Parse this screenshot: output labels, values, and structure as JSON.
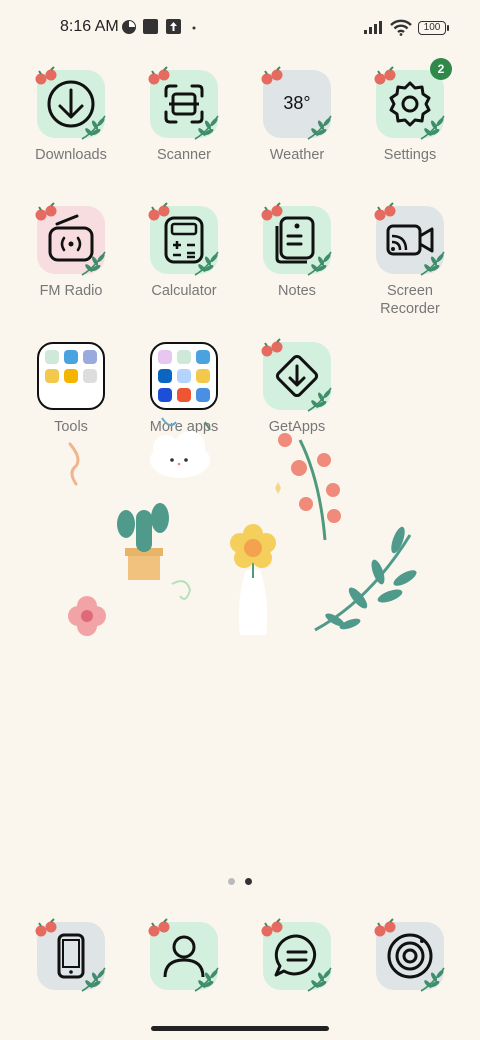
{
  "status_bar": {
    "time": "8:16 AM",
    "battery": "100"
  },
  "apps": [
    {
      "label": "Downloads",
      "icon": "download-icon",
      "bg": "#d3efde"
    },
    {
      "label": "Scanner",
      "icon": "scanner-icon",
      "bg": "#d3efde"
    },
    {
      "label": "Weather",
      "icon": "weather-icon",
      "bg": "#dfe4e6",
      "temp": "38°"
    },
    {
      "label": "Settings",
      "icon": "gear-icon",
      "bg": "#d3efde",
      "badge": "2"
    },
    {
      "label": "FM Radio",
      "icon": "radio-icon",
      "bg": "#f7dce0"
    },
    {
      "label": "Calculator",
      "icon": "calculator-icon",
      "bg": "#d3efde"
    },
    {
      "label": "Notes",
      "icon": "notes-icon",
      "bg": "#d3efde"
    },
    {
      "label": "Screen Recorder",
      "icon": "screen-recorder-icon",
      "bg": "#dfe4e6"
    },
    {
      "label": "Tools",
      "icon": "folder-icon"
    },
    {
      "label": "More apps",
      "icon": "folder-icon"
    },
    {
      "label": "GetApps",
      "icon": "getapps-icon",
      "bg": "#d3efde"
    }
  ],
  "dock": [
    {
      "icon": "phone-icon",
      "bg": "#dfe4e6"
    },
    {
      "icon": "contacts-icon",
      "bg": "#d3efde"
    },
    {
      "icon": "messages-icon",
      "bg": "#d3efde"
    },
    {
      "icon": "camera-icon",
      "bg": "#dfe4e6"
    }
  ],
  "page_indicator": {
    "pages": 2,
    "current": 2
  }
}
